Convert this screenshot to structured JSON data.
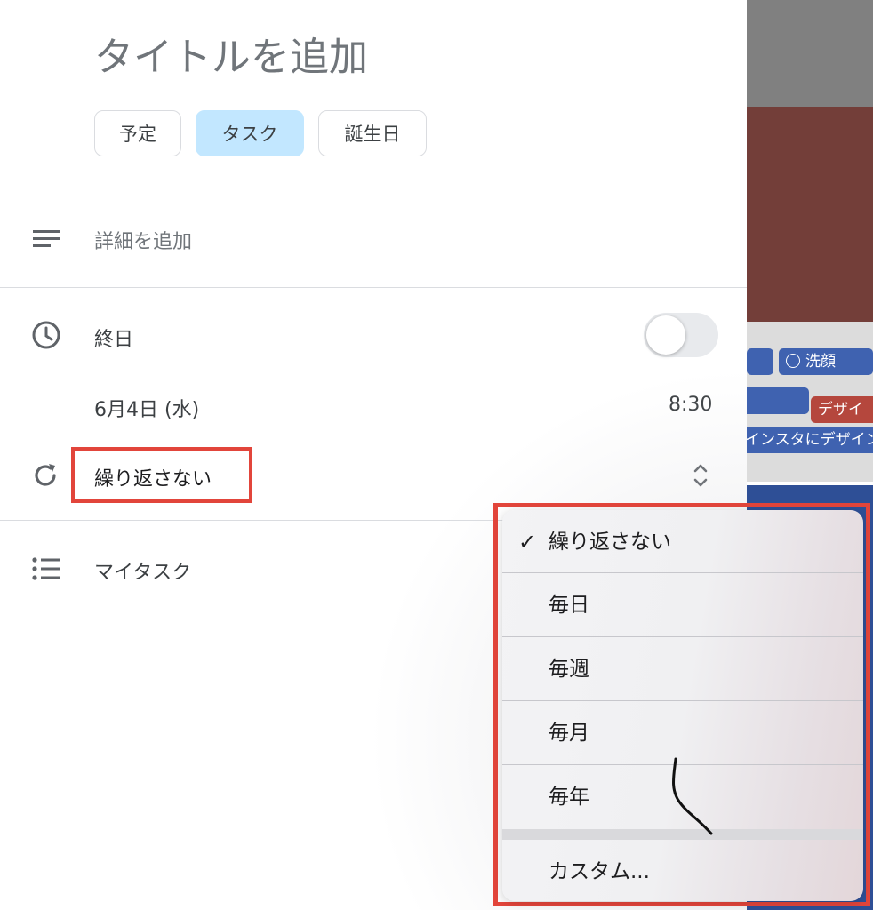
{
  "editor": {
    "title_placeholder": "タイトルを追加",
    "types": [
      {
        "label": "予定",
        "selected": false
      },
      {
        "label": "タスク",
        "selected": true
      },
      {
        "label": "誕生日",
        "selected": false
      }
    ],
    "details_placeholder": "詳細を追加",
    "all_day_label": "終日",
    "all_day_on": false,
    "date": "6月4日 (水)",
    "time": "8:30",
    "repeat_value": "繰り返さない",
    "task_list": "マイタスク"
  },
  "repeat_menu": {
    "items": [
      {
        "label": "繰り返さない",
        "checked": true
      },
      {
        "label": "毎日",
        "checked": false
      },
      {
        "label": "毎週",
        "checked": false
      },
      {
        "label": "毎月",
        "checked": false
      },
      {
        "label": "毎年",
        "checked": false
      },
      {
        "label": "カスタム...",
        "checked": false
      }
    ],
    "check_glyph": "✓"
  },
  "background_calendar": {
    "events": [
      "洗顔",
      "デザイ",
      "インスタにデザイン"
    ]
  },
  "colors": {
    "chip_selected": "#c2e7ff",
    "annotation_red": "#e2453b",
    "event_blue": "#3f62b0",
    "event_red": "#b5473d"
  },
  "icons": [
    "notes-icon",
    "clock-icon",
    "repeat-icon",
    "list-icon",
    "sort-arrows-icon",
    "check-circle-icon"
  ]
}
